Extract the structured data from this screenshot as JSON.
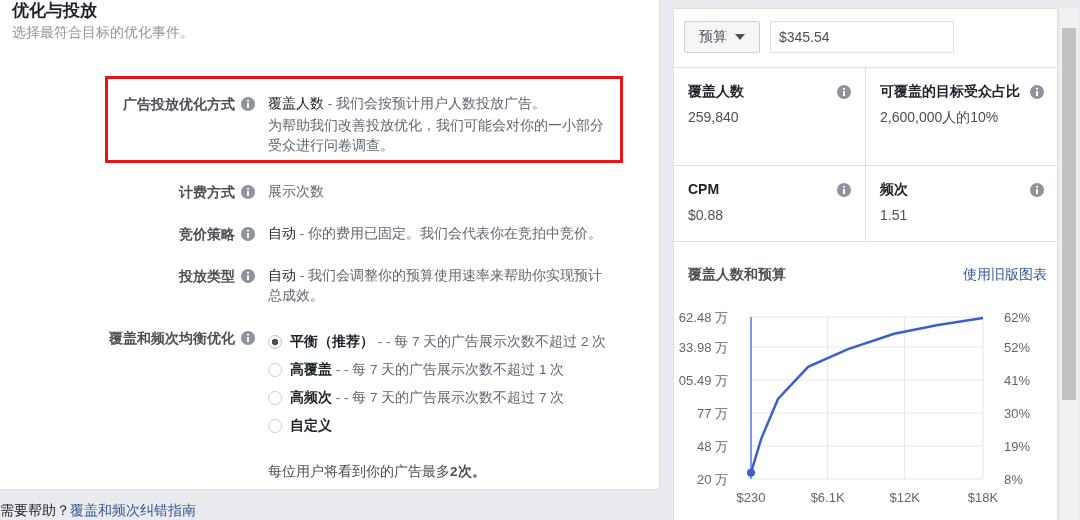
{
  "section": {
    "title": "优化与投放",
    "subtitle": "选择最符合目标的优化事件。"
  },
  "rows": [
    {
      "label": "广告投放优化方式",
      "lead": "覆盖人数",
      "text": " - 我们会按预计用户人数投放广告。",
      "note": "为帮助我们改善投放优化，我们可能会对你的一小部分受众进行问卷调查。",
      "highlighted": true
    },
    {
      "label": "计费方式",
      "text": "展示次数",
      "highlighted": false
    },
    {
      "label": "竞价策略",
      "lead": "自动",
      "text": " - 你的费用已固定。我们会代表你在竞拍中竞价。",
      "highlighted": false
    },
    {
      "label": "投放类型",
      "lead": "自动",
      "text": " - 我们会调整你的预算使用速率来帮助你实现预计总成效。",
      "highlighted": false
    }
  ],
  "balance": {
    "label": "覆盖和频次均衡优化",
    "options": [
      {
        "label": "平衡（推荐）",
        "text": " - - 每 7 天的广告展示次数不超过 2 次",
        "selected": true
      },
      {
        "label": "高覆盖",
        "text": " - - 每 7 天的广告展示次数不超过 1 次",
        "selected": false
      },
      {
        "label": "高频次",
        "text": " - - 每 7 天的广告展示次数不超过 7 次",
        "selected": false
      },
      {
        "label": "自定义",
        "selected": false
      }
    ],
    "note": "每位用户将看到你的广告最多**2次。**"
  },
  "help": {
    "text": "需要帮助？",
    "link": "覆盖和频次纠错指南"
  },
  "budget": {
    "dropdown": "预算",
    "value": "$345.54"
  },
  "stats": [
    {
      "label": "覆盖人数",
      "value": "259,840"
    },
    {
      "label": "可覆盖的目标受众占比",
      "value": "2,600,000人的10%"
    },
    {
      "label": "CPM",
      "value": "$0.88"
    },
    {
      "label": "频次",
      "value": "1.51"
    }
  ],
  "chart": {
    "title": "覆盖人数和预算",
    "link": "使用旧版图表",
    "chart_data": {
      "type": "line",
      "x": [
        230,
        1000,
        2300,
        4600,
        7660,
        11200,
        14550,
        18000
      ],
      "series": [
        {
          "color": "#3b5fd0",
          "values": [
            10.1,
            21.3,
            34.7,
            45.4,
            51.3,
            56.4,
            59.3,
            61.7
          ]
        }
      ],
      "xlim": [
        230,
        18000
      ],
      "ylim": [
        8,
        62
      ],
      "xticks": [
        {
          "value": 230,
          "label": "$230"
        },
        {
          "value": 6100,
          "label": "$6.1K"
        },
        {
          "value": 12000,
          "label": "$12K"
        },
        {
          "value": 18000,
          "label": "$18K"
        }
      ],
      "yticks": [
        {
          "value": 8,
          "label": "8%"
        },
        {
          "value": 19,
          "label": "19%"
        },
        {
          "value": 30,
          "label": "30%"
        },
        {
          "value": 41,
          "label": "41%"
        },
        {
          "value": 52,
          "label": "52%"
        },
        {
          "value": 62,
          "label": "62%"
        }
      ],
      "grid": true,
      "annotations": [
        "20 万",
        "48 万",
        "77 万",
        "05.49 万",
        "33.98 万",
        "62.48 万"
      ]
    }
  }
}
